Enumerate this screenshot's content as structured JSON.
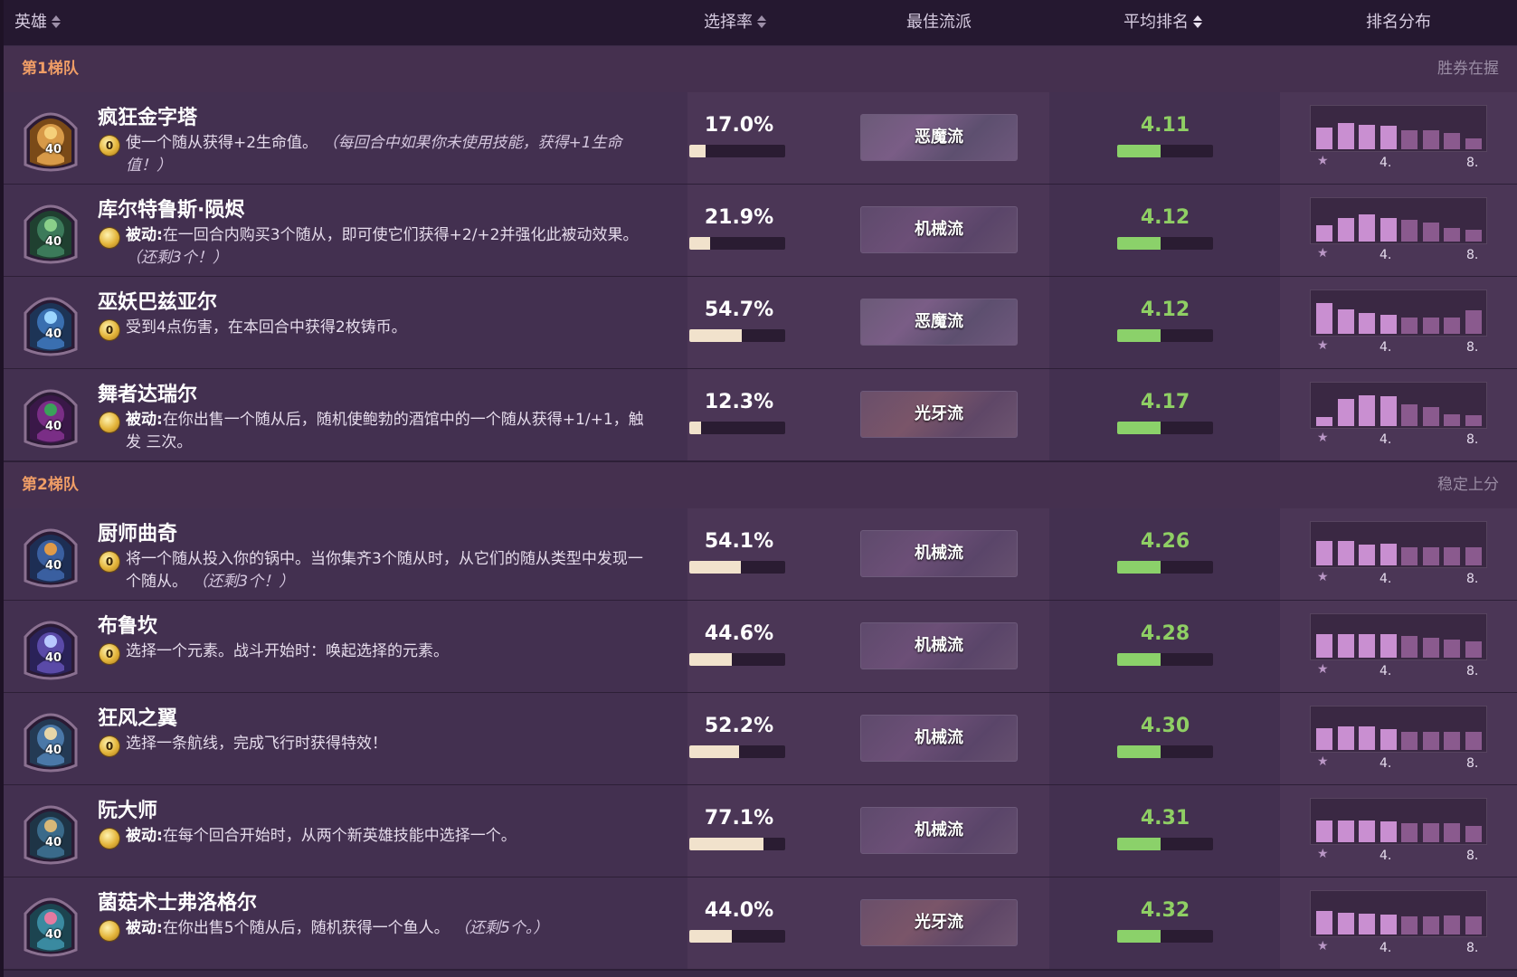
{
  "header": {
    "hero": "英雄",
    "pick_rate": "选择率",
    "best_comp": "最佳流派",
    "avg_rank": "平均排名",
    "rank_dist": "排名分布"
  },
  "colors": {
    "tier_label": "#ef9d66",
    "rank_value": "#8fcf64",
    "rank_bar": "#8bd16a",
    "pick_bar": "#f1e2cc",
    "dist_top": "#c98fd1",
    "dist_rest": "#8a5a8e"
  },
  "tiers": [
    {
      "label": "第1梯队",
      "note": "胜券在握"
    },
    {
      "label": "第2梯队",
      "note": "稳定上分"
    }
  ],
  "heroes": [
    {
      "name": "疯狂金字塔",
      "level": "40",
      "coin": "0",
      "keyword": "",
      "desc": "使一个随从获得+2生命值。",
      "note": "（每回合中如果你未使用技能，获得+1生命值！）",
      "pick": "17.0%",
      "pick_frac": 0.17,
      "comp": "恶魔流",
      "comp_style": "demon",
      "rank": "4.11",
      "rank_frac": 0.45,
      "dist": [
        0.55,
        0.65,
        0.62,
        0.58,
        0.48,
        0.48,
        0.4,
        0.28
      ],
      "icon": "pyramid-hero-portrait"
    },
    {
      "name": "库尔特鲁斯·陨烬",
      "level": "40",
      "coin": "",
      "keyword": "被动:",
      "desc": "在一回合内购买3个随从，即可使它们获得+2/+2并强化此被动效果。",
      "note": "（还剩3个！）",
      "pick": "21.9%",
      "pick_frac": 0.219,
      "comp": "机械流",
      "comp_style": "mech",
      "rank": "4.12",
      "rank_frac": 0.45,
      "dist": [
        0.42,
        0.58,
        0.68,
        0.6,
        0.55,
        0.48,
        0.35,
        0.3
      ],
      "icon": "kurtrus-hero-portrait"
    },
    {
      "name": "巫妖巴兹亚尔",
      "level": "40",
      "coin": "0",
      "keyword": "",
      "desc": "受到4点伤害，在本回合中获得2枚铸币。",
      "note": "",
      "pick": "54.7%",
      "pick_frac": 0.547,
      "comp": "恶魔流",
      "comp_style": "demon",
      "rank": "4.12",
      "rank_frac": 0.45,
      "dist": [
        0.78,
        0.62,
        0.52,
        0.48,
        0.42,
        0.4,
        0.42,
        0.58
      ],
      "icon": "lich-bazhial-hero-portrait"
    },
    {
      "name": "舞者达瑞尔",
      "level": "40",
      "coin": "",
      "keyword": "被动:",
      "desc": "在你出售一个随从后，随机使鲍勃的酒馆中的一个随从获得+1/+1，触发 三次。",
      "note": "",
      "pick": "12.3%",
      "pick_frac": 0.123,
      "comp": "光牙流",
      "comp_style": "ship",
      "rank": "4.17",
      "rank_frac": 0.45,
      "dist": [
        0.22,
        0.68,
        0.78,
        0.75,
        0.55,
        0.48,
        0.3,
        0.28
      ],
      "icon": "dancin-daryl-hero-portrait"
    },
    {
      "name": "厨师曲奇",
      "level": "40",
      "coin": "0",
      "keyword": "",
      "desc": "将一个随从投入你的锅中。当你集齐3个随从时，从它们的随从类型中发现一个随从。",
      "note": "（还剩3个！）",
      "pick": "54.1%",
      "pick_frac": 0.541,
      "comp": "机械流",
      "comp_style": "mech",
      "rank": "4.26",
      "rank_frac": 0.45,
      "dist": [
        0.62,
        0.62,
        0.52,
        0.55,
        0.45,
        0.45,
        0.45,
        0.45
      ],
      "icon": "cookie-hero-portrait"
    },
    {
      "name": "布鲁坎",
      "level": "40",
      "coin": "0",
      "keyword": "",
      "desc": "选择一个元素。战斗开始时：唤起选择的元素。",
      "note": "",
      "pick": "44.6%",
      "pick_frac": 0.446,
      "comp": "机械流",
      "comp_style": "mech",
      "rank": "4.28",
      "rank_frac": 0.45,
      "dist": [
        0.58,
        0.58,
        0.58,
        0.58,
        0.55,
        0.5,
        0.45,
        0.4
      ],
      "icon": "bru-kan-hero-portrait"
    },
    {
      "name": "狂风之翼",
      "level": "40",
      "coin": "0",
      "keyword": "",
      "desc": "选择一条航线，完成飞行时获得特效！",
      "note": "",
      "pick": "52.2%",
      "pick_frac": 0.522,
      "comp": "机械流",
      "comp_style": "mech",
      "rank": "4.30",
      "rank_frac": 0.45,
      "dist": [
        0.55,
        0.58,
        0.58,
        0.52,
        0.45,
        0.45,
        0.45,
        0.45
      ],
      "icon": "galewing-hero-portrait"
    },
    {
      "name": "阮大师",
      "level": "40",
      "coin": "",
      "keyword": "被动:",
      "desc": "在每个回合开始时，从两个新英雄技能中选择一个。",
      "note": "",
      "pick": "77.1%",
      "pick_frac": 0.771,
      "comp": "机械流",
      "comp_style": "mech",
      "rank": "4.31",
      "rank_frac": 0.45,
      "dist": [
        0.55,
        0.55,
        0.55,
        0.52,
        0.48,
        0.48,
        0.48,
        0.42
      ],
      "icon": "master-nguyen-hero-portrait"
    },
    {
      "name": "菌菇术士弗洛格尔",
      "level": "40",
      "coin": "",
      "keyword": "被动:",
      "desc": "在你出售5个随从后，随机获得一个鱼人。",
      "note": "（还剩5个。）",
      "pick": "44.0%",
      "pick_frac": 0.44,
      "comp": "光牙流",
      "comp_style": "ship",
      "rank": "4.32",
      "rank_frac": 0.45,
      "dist": [
        0.58,
        0.55,
        0.52,
        0.5,
        0.45,
        0.45,
        0.48,
        0.45
      ],
      "icon": "flurgl-hero-portrait"
    }
  ],
  "dist_axis": {
    "mid": "4.",
    "end": "8."
  }
}
